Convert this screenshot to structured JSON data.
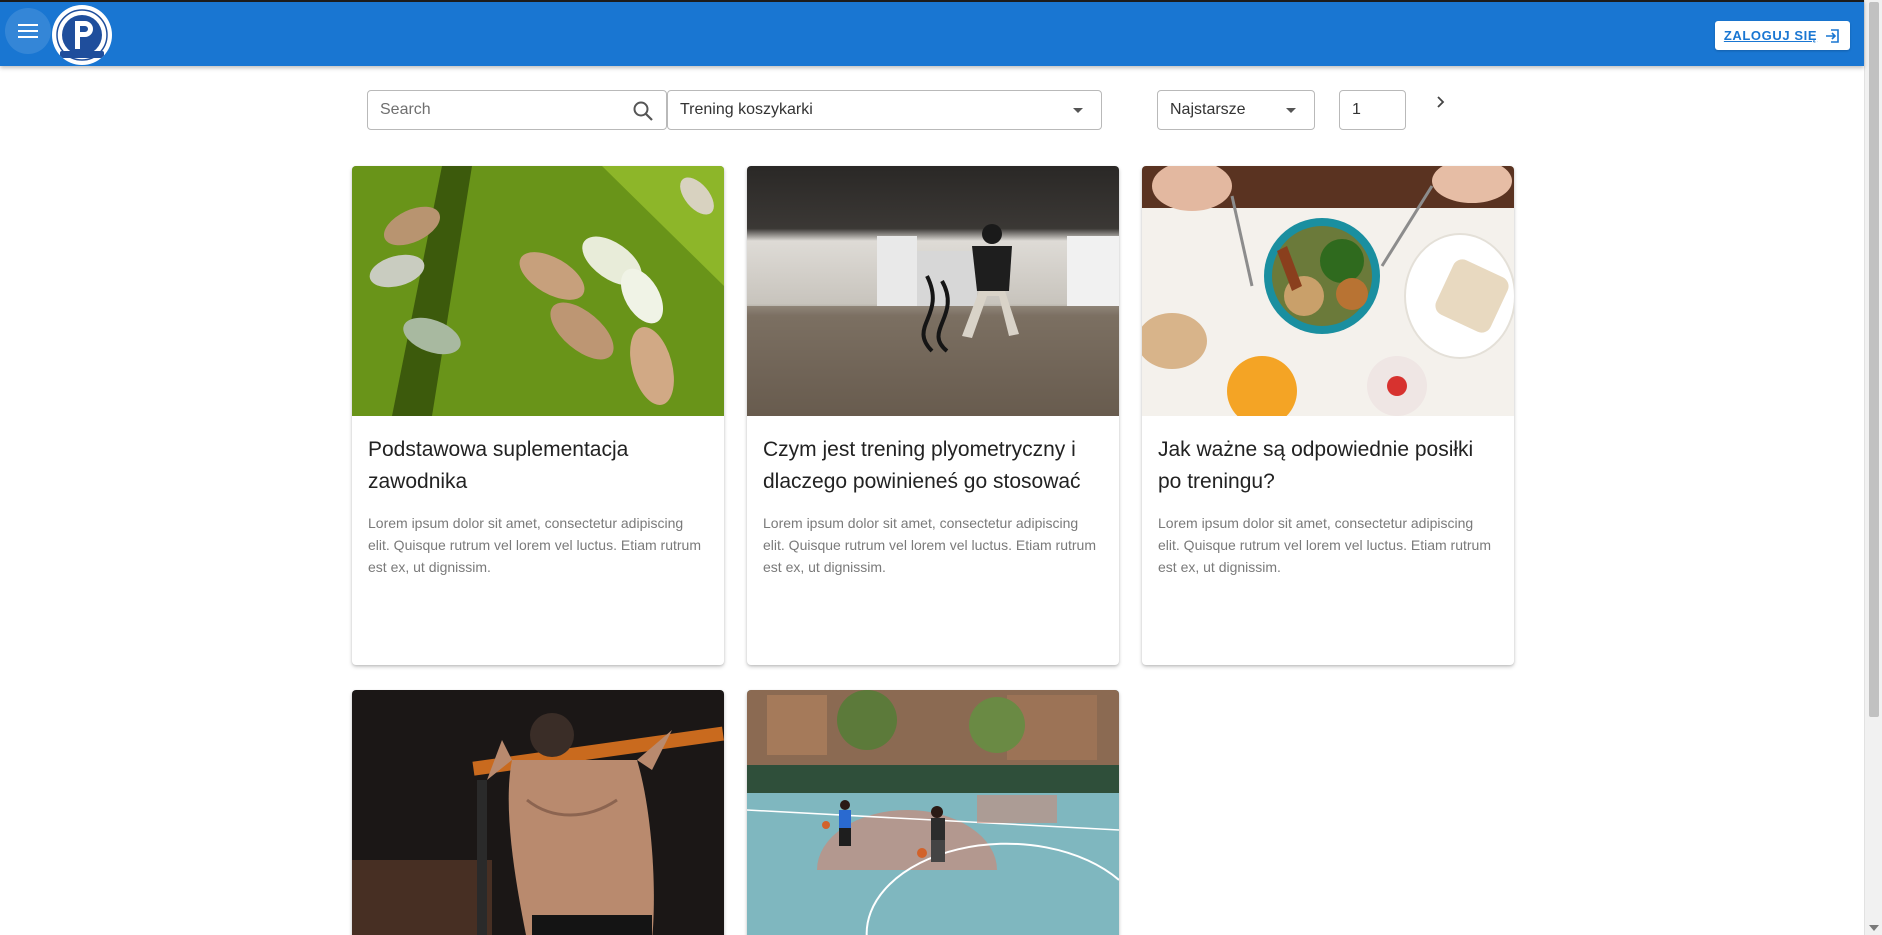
{
  "header": {
    "menu_icon": "menu-icon",
    "logo_icon": "club-logo",
    "login_label": "ZALOGUJ SIĘ",
    "login_icon": "login-icon",
    "brand_color": "#1976d2"
  },
  "filters": {
    "search_placeholder": "Search",
    "search_value": "",
    "category_value": "Trening koszykarki",
    "sort_value": "Najstarsze",
    "page_value": "1",
    "next_icon": "chevron-right-icon"
  },
  "articles": [
    {
      "title": "Podstawowa suplementacja zawodnika",
      "excerpt": "Lorem ipsum dolor sit amet, consectetur adipiscing elit. Quisque rutrum vel lorem vel luctus. Etiam rutrum est ex, ut dignissim.",
      "image": "supplement-pills-image"
    },
    {
      "title": "Czym jest trening plyometryczny i dlaczego powinieneś go stosować",
      "excerpt": "Lorem ipsum dolor sit amet, consectetur adipiscing elit. Quisque rutrum vel lorem vel luctus. Etiam rutrum est ex, ut dignissim.",
      "image": "battle-ropes-training-image"
    },
    {
      "title": "Jak ważne są odpowiednie posiłki po treningu?",
      "excerpt": "Lorem ipsum dolor sit amet, consectetur adipiscing elit. Quisque rutrum vel lorem vel luctus. Etiam rutrum est ex, ut dignissim.",
      "image": "healthy-meal-bowl-image"
    },
    {
      "title": "",
      "excerpt": "",
      "image": "pull-up-workout-image"
    },
    {
      "title": "",
      "excerpt": "",
      "image": "basketball-court-image"
    }
  ]
}
